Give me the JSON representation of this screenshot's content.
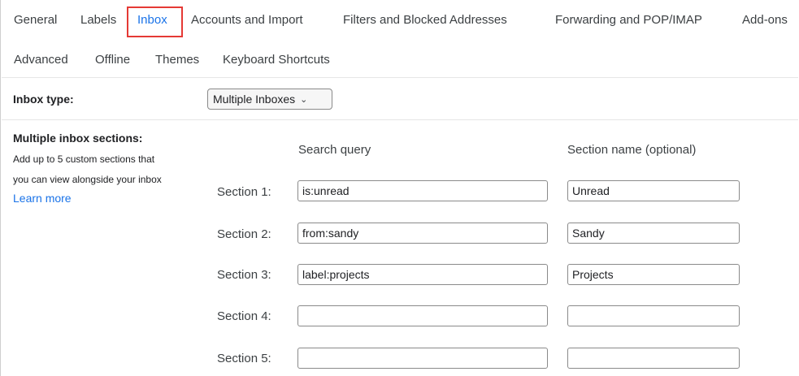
{
  "tabs_row1": [
    "General",
    "Labels",
    "Inbox",
    "Accounts and Import",
    "Filters and Blocked Addresses",
    "Forwarding and POP/IMAP",
    "Add-ons"
  ],
  "tabs_row2": [
    "Advanced",
    "Offline",
    "Themes",
    "Keyboard Shortcuts"
  ],
  "active_tab": "Inbox",
  "inbox_type": {
    "label": "Inbox type:",
    "selected": "Multiple Inboxes"
  },
  "multiple_inbox": {
    "title": "Multiple inbox sections:",
    "desc_line1": "Add up to 5 custom sections that",
    "desc_line2": "you can view alongside your inbox",
    "learn_more": "Learn more",
    "col_query": "Search query",
    "col_name": "Section name (optional)",
    "sections": [
      {
        "label": "Section 1:",
        "query": "is:unread",
        "name": "Unread"
      },
      {
        "label": "Section 2:",
        "query": "from:sandy",
        "name": "Sandy"
      },
      {
        "label": "Section 3:",
        "query": "label:projects",
        "name": "Projects"
      },
      {
        "label": "Section 4:",
        "query": "",
        "name": ""
      },
      {
        "label": "Section 5:",
        "query": "",
        "name": ""
      }
    ]
  },
  "colors": {
    "accent": "#1a73e8",
    "highlight": "#e53935"
  }
}
